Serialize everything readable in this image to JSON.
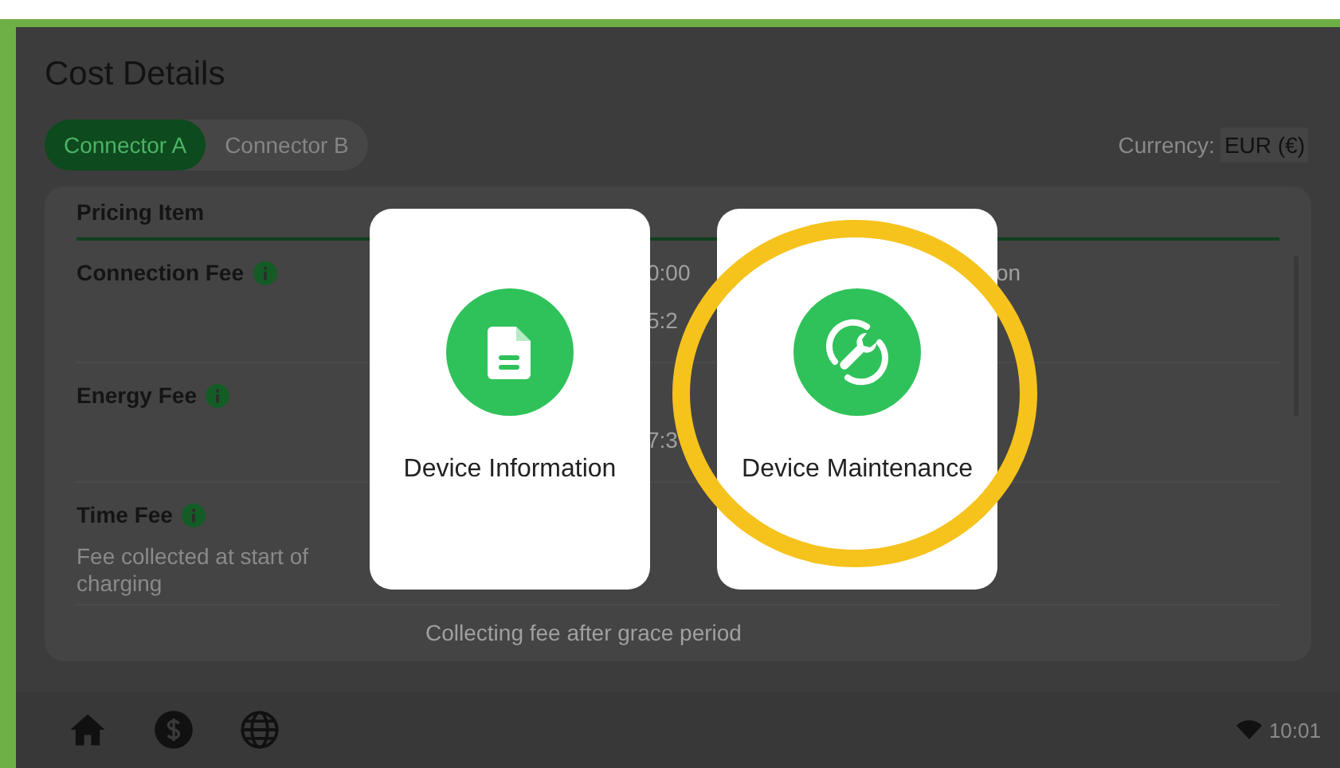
{
  "title": "Cost Details",
  "tabs": [
    {
      "label": "Connector A",
      "selected": true
    },
    {
      "label": "Connector B",
      "selected": false
    }
  ],
  "currency": {
    "label": "Currency:",
    "value": "EUR (€)"
  },
  "table": {
    "header": "Pricing Item",
    "rows": [
      {
        "name": "Connection Fee",
        "lines": [
          {
            "mid": "0:00",
            "right": "on"
          },
          {
            "mid": "5:2"
          }
        ]
      },
      {
        "name": "Energy Fee",
        "lines": [
          {
            "mid": "7:3"
          }
        ]
      },
      {
        "name": "Time Fee",
        "description": "Fee collected at start of charging"
      }
    ],
    "note": "Collecting fee after grace period"
  },
  "menu": [
    {
      "label": "Device Information",
      "kind": "document",
      "highlighted": false
    },
    {
      "label": "Device Maintenance",
      "kind": "wrench",
      "highlighted": true
    }
  ],
  "status": {
    "time": "10:01"
  }
}
